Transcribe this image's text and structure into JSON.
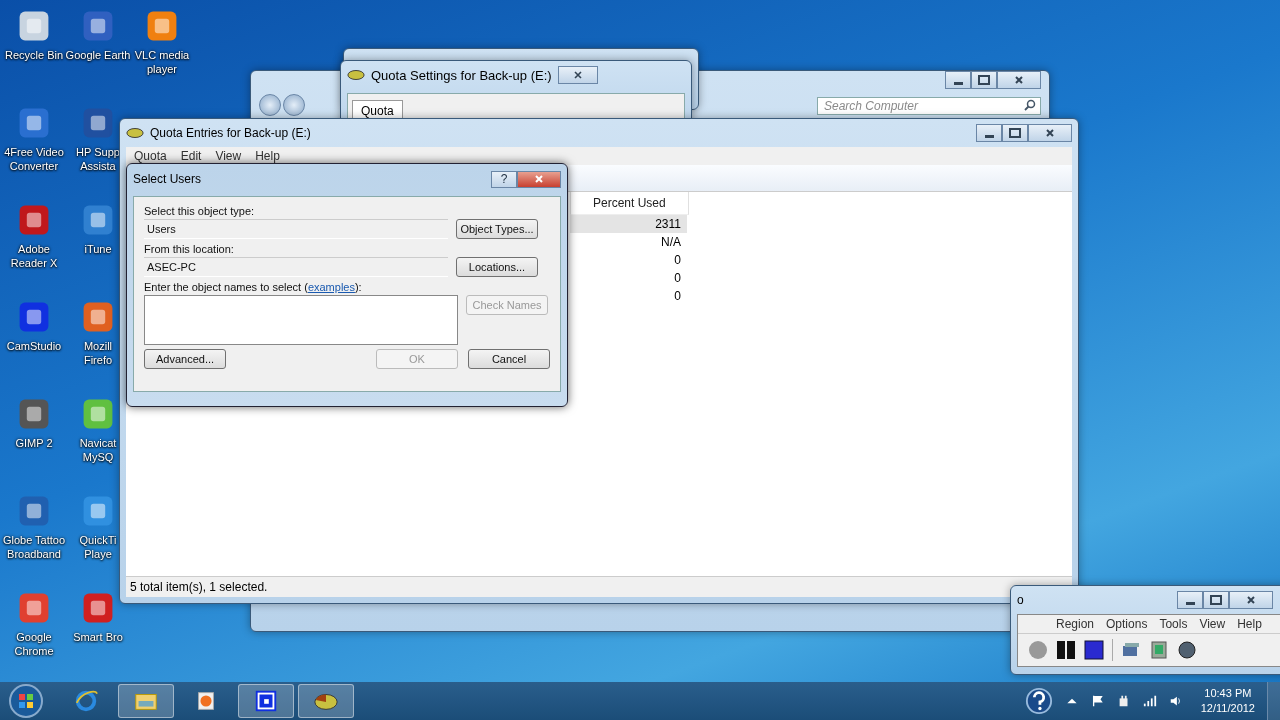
{
  "desktop": {
    "icons": [
      {
        "lines": [
          "Recycle Bin"
        ]
      },
      {
        "lines": [
          "4Free Video",
          "Converter"
        ]
      },
      {
        "lines": [
          "Adobe",
          "Reader X"
        ]
      },
      {
        "lines": [
          "CamStudio"
        ]
      },
      {
        "lines": [
          "GIMP 2"
        ]
      },
      {
        "lines": [
          "Globe Tattoo",
          "Broadband"
        ]
      },
      {
        "lines": [
          "Google",
          "Chrome"
        ]
      },
      {
        "lines": [
          "Google Earth"
        ]
      },
      {
        "lines": [
          "HP Supp",
          "Assista"
        ]
      },
      {
        "lines": [
          "iTune"
        ]
      },
      {
        "lines": [
          "Mozill",
          "Firefo"
        ]
      },
      {
        "lines": [
          "Navicat",
          "MySQ"
        ]
      },
      {
        "lines": [
          "QuickTi",
          "Playe"
        ]
      },
      {
        "lines": [
          "Smart Bro"
        ]
      },
      {
        "lines": [
          "VLC media",
          "player"
        ]
      }
    ]
  },
  "computer_window": {
    "search": {
      "placeholder": "Search Computer"
    }
  },
  "quota_settings": {
    "title": "Quota Settings for Back-up (E:)",
    "tabs": [
      {
        "label": "Quota",
        "selected": true
      }
    ]
  },
  "quota_entries": {
    "title": "Quota Entries for Back-up (E:)",
    "menu": [
      "Quota",
      "Edit",
      "View",
      "Help"
    ],
    "table": {
      "columns": [
        "Percent Used"
      ],
      "rows": [
        {
          "percent_used": "2311",
          "selected": true
        },
        {
          "percent_used": "N/A",
          "selected": false
        },
        {
          "percent_used": "0",
          "selected": false
        },
        {
          "percent_used": "0",
          "selected": false
        },
        {
          "percent_used": "0",
          "selected": false
        }
      ]
    },
    "status_bar": "5 total item(s), 1 selected."
  },
  "select_users": {
    "title": "Select Users",
    "help": "?",
    "object_type_label": "Select this object type:",
    "object_type": "Users",
    "object_types_button": "Object Types...",
    "location_label": "From this location:",
    "location": "ASEC-PC",
    "locations_button": "Locations...",
    "names_label_before": "Enter the object names to select (",
    "names_link": "examples",
    "names_label_after": "):",
    "check_names": {
      "label": "Check Names",
      "disabled": true
    },
    "advanced_button": "Advanced...",
    "ok": {
      "label": "OK",
      "disabled": true
    },
    "cancel_button": "Cancel"
  },
  "camstudio": {
    "title": "o",
    "menu": [
      "Region",
      "Options",
      "Tools",
      "View",
      "Help"
    ]
  },
  "taskbar": {
    "buttons": [
      {
        "kind": "ie",
        "selected": false
      },
      {
        "kind": "folder",
        "selected": true
      },
      {
        "kind": "media",
        "selected": false
      },
      {
        "kind": "camstudio",
        "selected": true
      },
      {
        "kind": "quota",
        "selected": true
      }
    ],
    "time": "10:43 PM",
    "date": "12/11/2012"
  }
}
